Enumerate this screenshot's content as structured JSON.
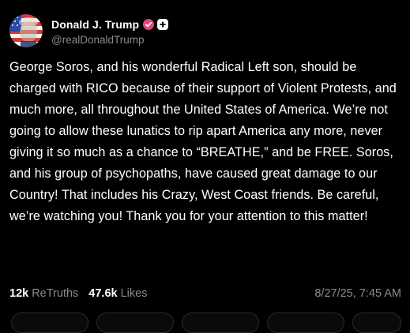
{
  "post": {
    "author": {
      "display_name": "Donald J. Trump",
      "handle": "@realDonaldTrump",
      "verified_icon": "verified-badge-icon",
      "verified_color": "#e0457b",
      "extra_badge_icon": "plus-icon"
    },
    "text": "George Soros, and his wonderful Radical Left son, should be charged with RICO because of their support of Violent Protests, and much more, all throughout the United States of America. We’re not going to allow these lunatics to rip apart America any more, never giving it so much as a chance to “BREATHE,” and be FREE. Soros, and his group of psychopaths, have caused great damage to our Country! That includes his Crazy, West Coast friends. Be careful, we’re watching you! Thank you for your attention to this matter!",
    "stats": {
      "retruths_count": "12k",
      "retruths_label": "ReTruths",
      "likes_count": "47.6k",
      "likes_label": "Likes"
    },
    "timestamp": "8/27/25, 7:45 AM"
  },
  "colors": {
    "background": "#000000",
    "text_primary": "#ffffff",
    "text_secondary": "#8b8b8b"
  }
}
